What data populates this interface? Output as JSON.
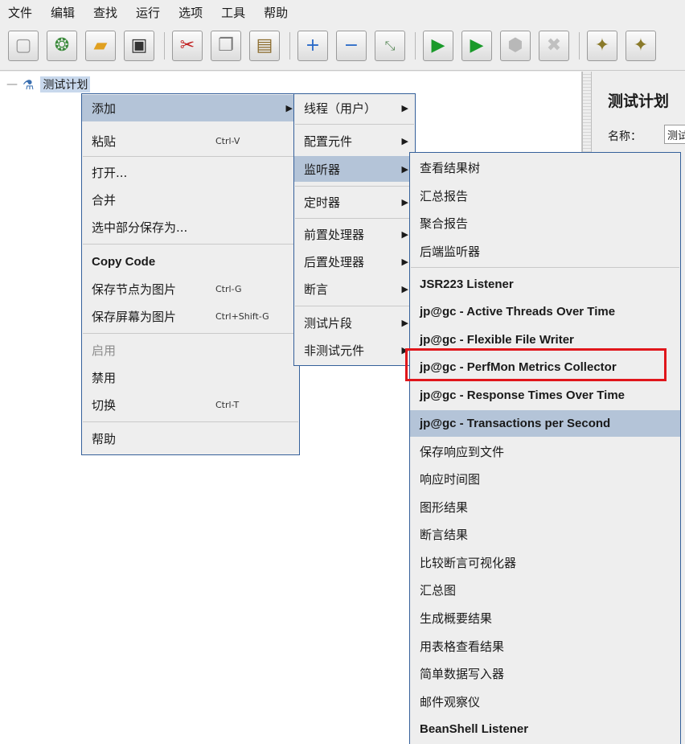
{
  "menubar": [
    "文件",
    "编辑",
    "查找",
    "运行",
    "选项",
    "工具",
    "帮助"
  ],
  "toolbar": {
    "icons": [
      "new-icon",
      "templates-icon",
      "open-icon",
      "save-icon",
      "cut-icon",
      "copy-icon",
      "paste-icon",
      "expand-icon",
      "collapse-icon",
      "toggle-icon",
      "start-icon",
      "start-no-pause-icon",
      "stop-icon",
      "shutdown-icon",
      "clear-icon",
      "clear-all-icon"
    ]
  },
  "tree": {
    "root": "测试计划"
  },
  "right_panel": {
    "title": "测试计划",
    "name_label": "名称：",
    "name_value": "测试"
  },
  "context_menu": {
    "items": [
      {
        "label": "添加",
        "submenu": true
      },
      {
        "label": "粘贴",
        "shortcut": "Ctrl-V"
      },
      {
        "label": "打开..."
      },
      {
        "label": "合并"
      },
      {
        "label": "选中部分保存为..."
      },
      {
        "label": "Copy Code"
      },
      {
        "label": "保存节点为图片",
        "shortcut": "Ctrl-G"
      },
      {
        "label": "保存屏幕为图片",
        "shortcut": "Ctrl+Shift-G"
      },
      {
        "label": "启用",
        "disabled": true
      },
      {
        "label": "禁用"
      },
      {
        "label": "切换",
        "shortcut": "Ctrl-T"
      },
      {
        "label": "帮助"
      }
    ]
  },
  "add_submenu": {
    "items": [
      "线程（用户）",
      "配置元件",
      "监听器",
      "定时器",
      "前置处理器",
      "后置处理器",
      "断言",
      "测试片段",
      "非测试元件"
    ]
  },
  "listener_submenu": {
    "items": [
      "查看结果树",
      "汇总报告",
      "聚合报告",
      "后端监听器",
      "JSR223 Listener",
      "jp@gc - Active Threads Over Time",
      "jp@gc - Flexible File Writer",
      "jp@gc - PerfMon Metrics Collector",
      "jp@gc - Response Times Over Time",
      "jp@gc - Transactions per Second",
      "保存响应到文件",
      "响应时间图",
      "图形结果",
      "断言结果",
      "比较断言可视化器",
      "汇总图",
      "生成概要结果",
      "用表格查看结果",
      "简单数据写入器",
      "邮件观察仪",
      "BeanShell Listener"
    ]
  },
  "colors": {
    "selection": "#b4c4d8",
    "menu_border": "#35609a",
    "annotation": "#e0161b"
  }
}
